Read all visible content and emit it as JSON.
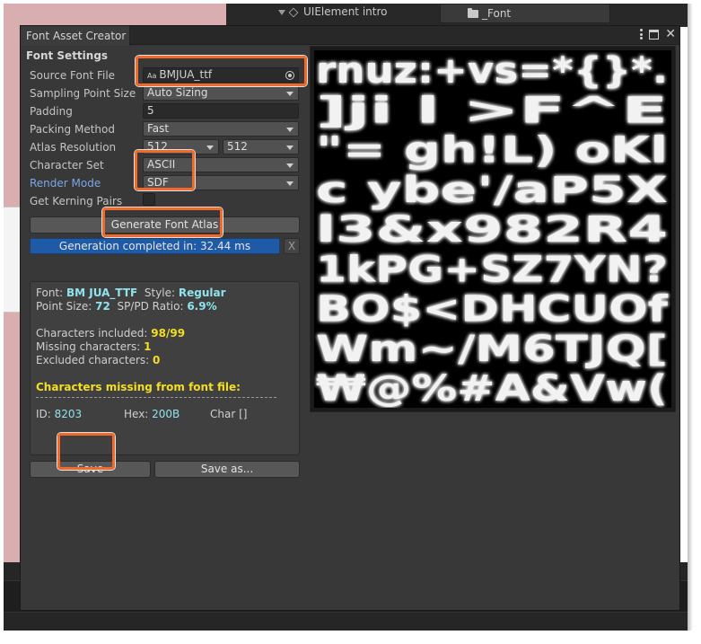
{
  "hierarchy": {
    "item_label": "UIElement intro"
  },
  "project": {
    "folder_label": "_Font"
  },
  "window": {
    "tab_title": "Font Asset Creator"
  },
  "settings": {
    "section_title": "Font Settings",
    "source_font_label": "Source Font File",
    "source_font_value": "BMJUA_ttf",
    "source_font_icon": "Aa",
    "sampling_label": "Sampling Point Size",
    "sampling_value": "Auto Sizing",
    "padding_label": "Padding",
    "padding_value": "5",
    "packing_label": "Packing Method",
    "packing_value": "Fast",
    "atlas_res_label": "Atlas Resolution",
    "atlas_width": "512",
    "atlas_height": "512",
    "charset_label": "Character Set",
    "charset_value": "ASCII",
    "render_mode_label": "Render Mode",
    "render_mode_value": "SDF",
    "kerning_label": "Get Kerning Pairs"
  },
  "actions": {
    "generate_label": "Generate Font Atlas",
    "progress_text": "Generation completed in: 32.44 ms",
    "progress_clear": "X",
    "save_label": "Save",
    "save_as_label": "Save as..."
  },
  "info": {
    "font_key": "Font: ",
    "font_value": "BM JUA_TTF",
    "style_key": "Style: ",
    "style_value": "Regular",
    "point_size_key": "Point Size: ",
    "point_size_value": "72",
    "ratio_key": "SP/PD Ratio: ",
    "ratio_value": "6.9%",
    "included_key": "Characters included: ",
    "included_value": "98/99",
    "missing_key": "Missing characters: ",
    "missing_value": "1",
    "excluded_key": "Excluded characters: ",
    "excluded_value": "0",
    "missing_header": "Characters missing from font file:",
    "id_key": "ID: ",
    "id_value": "8203",
    "hex_key": "Hex: ",
    "hex_value": "200B",
    "char_key": "Char []"
  },
  "atlas_rows": [
    "rnuz:+vs=*{}*.",
    "]ji  l  >F^E",
    "\"=  gh!L)  oKl",
    "c ybe'/aP5X",
    "l3&x982R4",
    "1kPG+SZ7YN?",
    "BO$<DHCUOf",
    "Wm~/M6TJQ[",
    "₩@%#A&Vw("
  ],
  "colors": {
    "accent": "#f06a2c",
    "progress": "#1e5aa6",
    "cyan": "#8fe3ee",
    "yellow": "#f3df22"
  }
}
